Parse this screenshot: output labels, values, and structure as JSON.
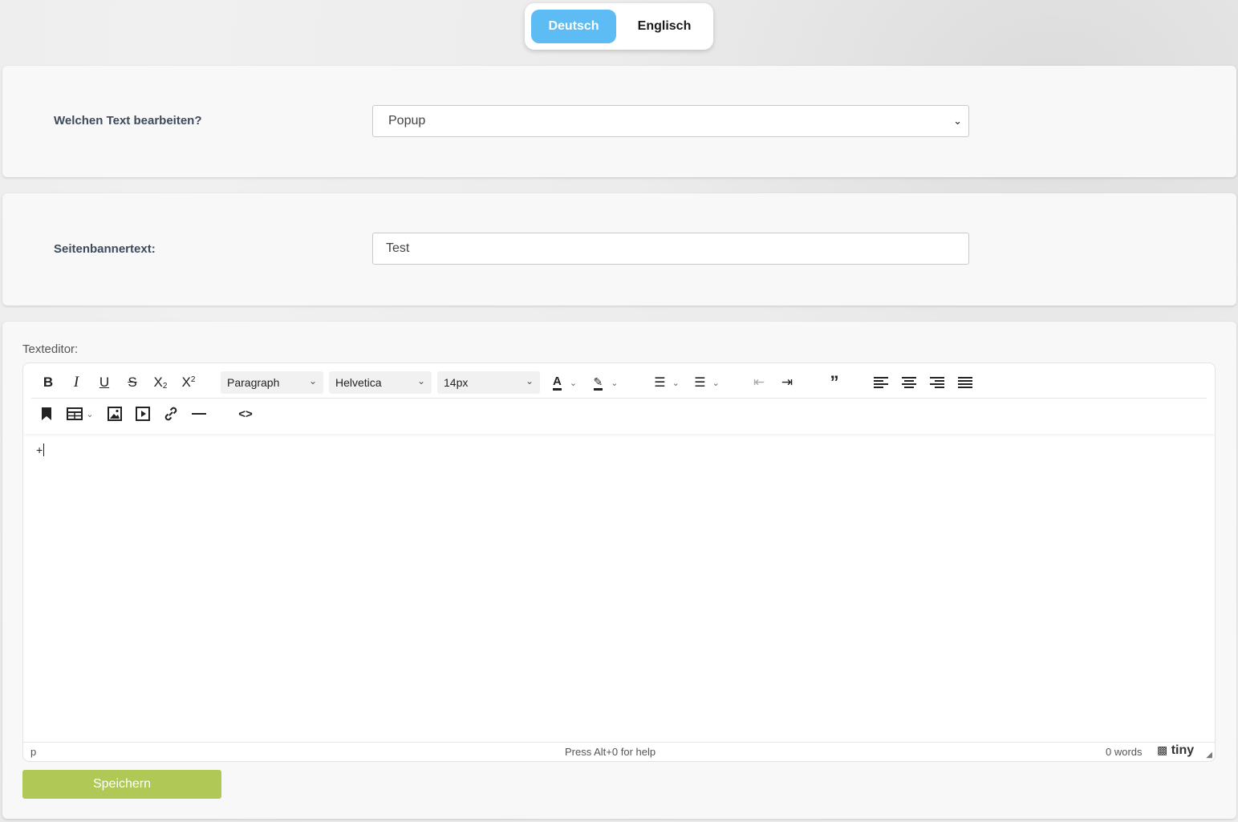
{
  "language_toggle": {
    "active": "Deutsch",
    "inactive": "Englisch"
  },
  "text_select": {
    "label": "Welchen Text bearbeiten?",
    "value": "Popup"
  },
  "banner": {
    "label": "Seitenbannertext:",
    "value": "Test"
  },
  "editor": {
    "label": "Texteditor:",
    "toolbar": {
      "block_format": "Paragraph",
      "font_family": "Helvetica",
      "font_size": "14px"
    },
    "content": "+",
    "status": {
      "path": "p",
      "help": "Press Alt+0 for help",
      "words": "0 words",
      "brand": "tiny"
    }
  },
  "save_label": "Speichern",
  "colors": {
    "accent_blue": "#5cbcf3",
    "save_green": "#b0c956"
  }
}
